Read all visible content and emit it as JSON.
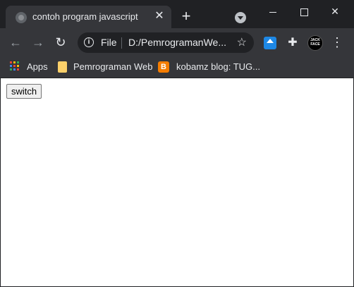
{
  "tab": {
    "title": "contoh program javascript",
    "close_glyph": "✕",
    "favicon_icon": "globe-icon"
  },
  "tabstrip": {
    "new_tab_glyph": "+"
  },
  "window_controls": {
    "close_glyph": "✕"
  },
  "toolbar": {
    "back_glyph": "←",
    "forward_glyph": "→",
    "reload_glyph": "↻",
    "info_glyph": "i",
    "scheme": "File",
    "url": "D:/PemrogramanWe...",
    "star_glyph": "☆",
    "puzzle_glyph": "✚",
    "avatar_text": "JACK FACE",
    "menu_glyph": "⋮"
  },
  "bookmarks": [
    {
      "label": "Apps",
      "icon": "apps-grid-icon"
    },
    {
      "label": "Pemrograman Web",
      "icon": "folder-icon"
    },
    {
      "label": "kobamz blog: TUG...",
      "icon": "blogger-icon",
      "icon_glyph": "B"
    }
  ],
  "page": {
    "switch_label": "switch"
  },
  "colors": {
    "titlebar": "#202124",
    "toolbar": "#35363a",
    "page_background": "#ffffff",
    "folder": "#fbd06a",
    "blogger": "#f57d00"
  }
}
